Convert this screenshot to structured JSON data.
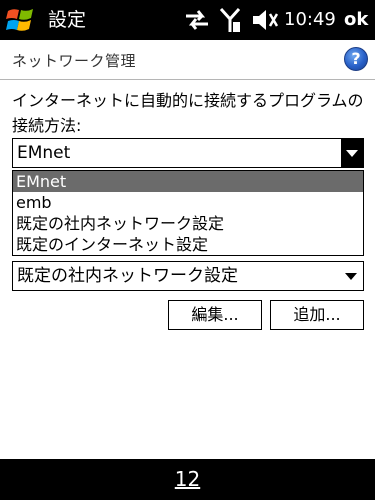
{
  "titlebar": {
    "title": "設定",
    "time": "10:49",
    "ok_label": "ok",
    "icons": [
      "windows-logo",
      "data-sync-icon",
      "signal-icon",
      "volume-muted-icon"
    ]
  },
  "header": {
    "title": "ネットワーク管理",
    "help_label": "?"
  },
  "prompt": "インターネットに自動的に接続するプログラムの接続方法:",
  "internet_combo": {
    "value": "EMnet",
    "options": [
      "EMnet",
      "emb",
      "既定の社内ネットワーク設定",
      "既定のインターネット設定"
    ],
    "selected_index": 0
  },
  "private_combo": {
    "value": "既定の社内ネットワーク設定"
  },
  "buttons": {
    "edit": "編集...",
    "add": "追加..."
  },
  "softbar": {
    "center": "12"
  },
  "colors": {
    "bar": "#000000",
    "selection": "#6b6b6b",
    "help_blue": "#2860c8"
  }
}
